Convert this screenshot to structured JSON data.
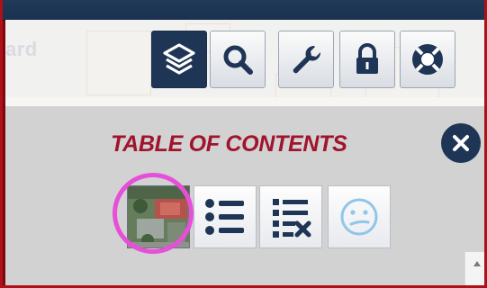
{
  "map": {
    "partial_label": "ard"
  },
  "toolbar": {
    "items": [
      {
        "icon": "layers-icon",
        "active": true
      },
      {
        "icon": "search-icon",
        "active": false
      },
      {
        "icon": "wrench-icon",
        "active": false
      },
      {
        "icon": "lock-icon",
        "active": false
      },
      {
        "icon": "lifebuoy-icon",
        "active": false
      }
    ]
  },
  "toc": {
    "title": "TABLE OF CONTENTS",
    "close_icon": "close-icon",
    "buttons": [
      {
        "icon": "basemap-thumbnail",
        "highlighted": true
      },
      {
        "icon": "list-icon"
      },
      {
        "icon": "list-remove-icon"
      },
      {
        "icon": "smiley-icon"
      }
    ]
  },
  "colors": {
    "frame": "#b01018",
    "navy": "#1f3556",
    "title": "#a0142c",
    "highlight_ring": "#e64fd8",
    "panel": "#d2d2d2"
  }
}
